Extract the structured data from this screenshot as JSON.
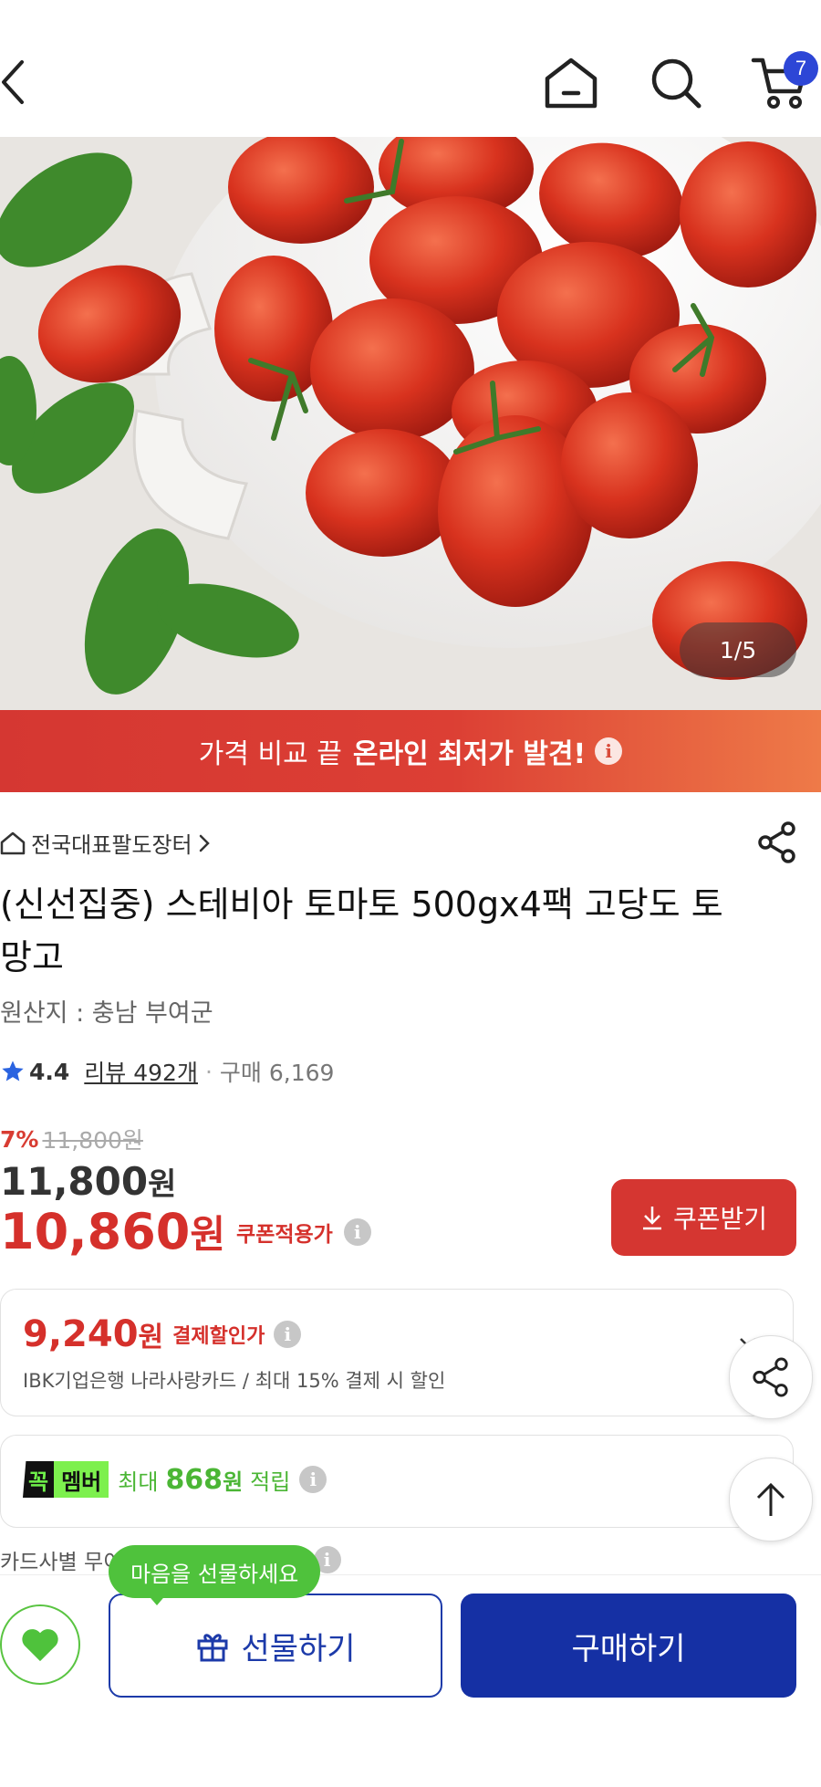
{
  "header": {
    "cart_count": "7"
  },
  "hero": {
    "image_index": "1/5"
  },
  "promo": {
    "text_normal": "가격 비교 끝",
    "text_bold": "온라인 최저가 발견!"
  },
  "product": {
    "store": "전국대표팔도장터",
    "title": "(신선집중) 스테비아 토마토 500gx4팩  고당도 토망고",
    "origin": "원산지 : 충남 부여군",
    "rating": "4.4",
    "review_text": "리뷰 492개",
    "purchase_text": "구매 6,169",
    "discount_pct": "7%",
    "original_price": "11,800원",
    "price_num": "11,800",
    "price_unit": "원",
    "coupon_price_num": "10,860",
    "coupon_price_unit": "원",
    "coupon_price_label": "쿠폰적용가",
    "coupon_button": "쿠폰받기"
  },
  "payment_discount": {
    "price_num": "9,240",
    "price_unit": "원",
    "label": "결제할인가",
    "description": "IBK기업은행 나라사랑카드 / 최대 15% 결제 시 할인"
  },
  "membership": {
    "logo_part1": "꼭",
    "logo_part2": "멤버",
    "text_prefix": "최대",
    "amount_num": "868",
    "amount_unit": "원",
    "text_suffix": "적립"
  },
  "card_note": "카드사별 무이자 할부 최대 22개월",
  "bottom_bar": {
    "tooltip": "마음을 선물하세요",
    "gift_button": "선물하기",
    "buy_button": "구매하기"
  },
  "colors": {
    "accent_red": "#d5302b",
    "primary_blue": "#1530a4",
    "member_green": "#4bb635"
  }
}
